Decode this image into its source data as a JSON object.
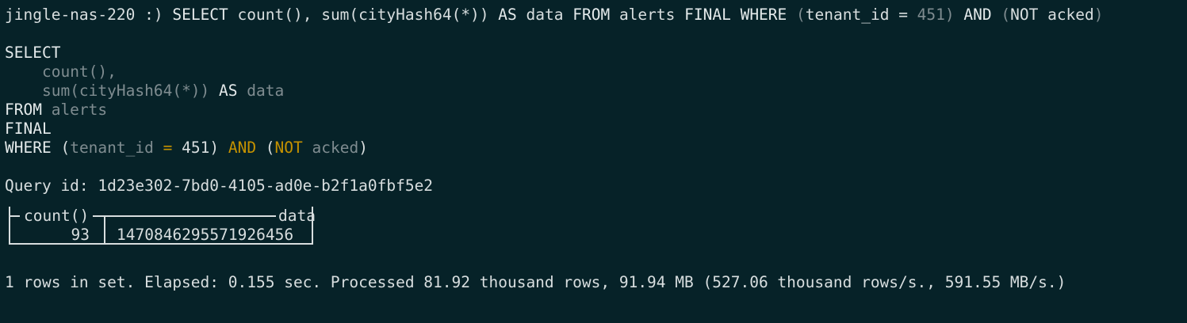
{
  "prompt": {
    "host": "jingle-nas-220",
    "prompt_suffix": " :) ",
    "command_select": "SELECT ",
    "command_count": "count(), ",
    "command_sum_open": "sum(",
    "command_cityhash": "cityHash64",
    "command_star": "(*)",
    "command_sum_close": ")",
    "command_as": " AS ",
    "command_data": "data ",
    "command_from": "FROM ",
    "command_alerts": "alerts ",
    "command_final": "FINAL ",
    "command_where": "WHERE ",
    "command_paren_open": "(",
    "command_tenant": "tenant_id ",
    "command_eq": "= ",
    "command_451": "451",
    "command_paren_close": ")",
    "command_and": " AND ",
    "command_not_open": "(",
    "command_not": "NOT ",
    "command_acked": "acked",
    "command_not_close": ")"
  },
  "formatted_query": {
    "select": "SELECT",
    "line_count_indent": "    ",
    "line_count": "count(),",
    "line_sum_indent": "    ",
    "line_sum_fn": "sum(cityHash64(*))",
    "line_sum_as": " AS ",
    "line_sum_alias": "data",
    "from_kw": "FROM ",
    "from_table": "alerts",
    "final": "FINAL",
    "where_kw": "WHERE ",
    "where_open": "(",
    "where_col": "tenant_id",
    "where_eq": " = ",
    "where_val": "451",
    "where_close": ")",
    "where_and": " AND ",
    "where_not_open": "(",
    "where_not": "NOT",
    "where_acked": " acked",
    "where_not_close": ")"
  },
  "query_id": {
    "label": "Query id: ",
    "value": "1d23e302-7bd0-4105-ad0e-b2f1a0fbf5e2"
  },
  "result": {
    "columns": [
      "count()",
      "data"
    ],
    "rows": [
      [
        "93",
        "1470846295571926456"
      ]
    ]
  },
  "status": {
    "text": "1 rows in set. Elapsed: 0.155 sec. Processed 81.92 thousand rows, 91.94 MB (527.06 thousand rows/s., 591.55 MB/s.)"
  },
  "colors": {
    "background": "#062228",
    "text": "#d8dedf",
    "dim": "#7f8c90",
    "operator": "#c59200"
  }
}
